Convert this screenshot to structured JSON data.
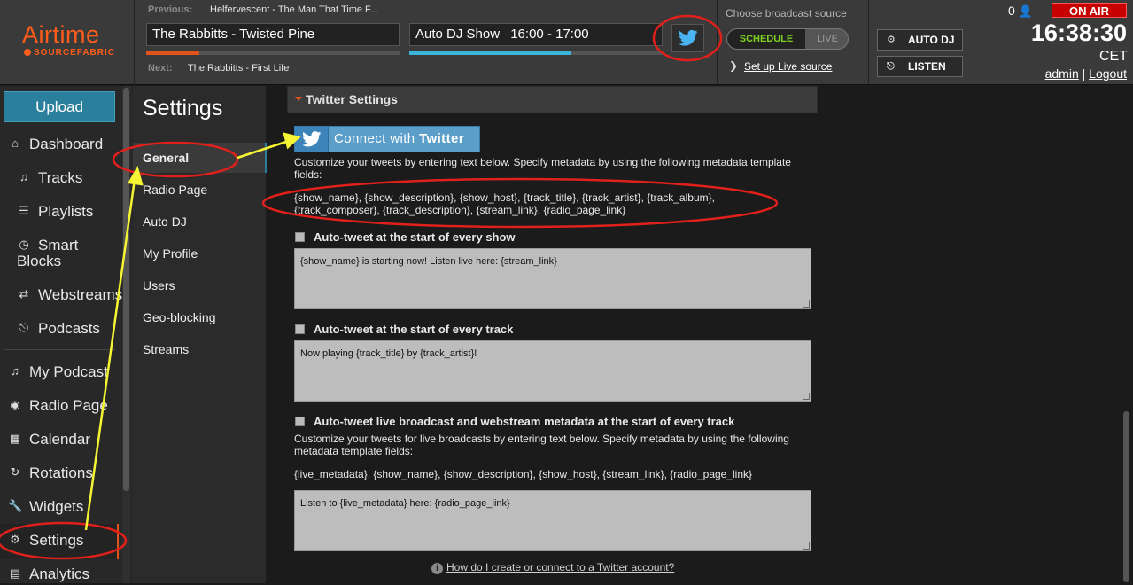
{
  "header": {
    "logo": {
      "name": "Airtime",
      "sub": "SOURCEFABRIC"
    },
    "previous_label": "Previous:",
    "previous_value": "Helfervescent - The Man That Time F...",
    "current_track": "The Rabbitts - Twisted Pine",
    "current_track_progress": 0.21,
    "current_show": "Auto DJ Show",
    "current_show_time": "16:00 - 17:00",
    "current_show_progress": 0.64,
    "next_label": "Next:",
    "next_value": "The Rabbitts - First Life",
    "source_title": "Choose broadcast source",
    "source_schedule": "SCHEDULE",
    "source_live": "LIVE",
    "setup_live": "Set up Live source",
    "autodj_label": "AUTO DJ",
    "listen_label": "LISTEN",
    "listener_count": "0",
    "onair": "ON AIR",
    "clock": "16:38:30",
    "timezone": "CET",
    "user": "admin",
    "separator": "|",
    "logout": "Logout"
  },
  "nav": {
    "upload": "Upload",
    "items": [
      {
        "label": "Dashboard",
        "icon": "home-icon"
      },
      {
        "label": "Tracks",
        "icon": "music-note-icon"
      },
      {
        "label": "Playlists",
        "icon": "list-icon"
      },
      {
        "label": "Smart",
        "label2": "Blocks",
        "icon": "clock-icon"
      },
      {
        "label": "Webstreams",
        "icon": "shuffle-icon"
      },
      {
        "label": "Podcasts",
        "icon": "headphones-icon"
      },
      {
        "label": "My Podcast",
        "icon": "music-note-icon"
      },
      {
        "label": "Radio Page",
        "icon": "globe-icon"
      },
      {
        "label": "Calendar",
        "icon": "calendar-icon"
      },
      {
        "label": "Rotations",
        "icon": "refresh-icon"
      },
      {
        "label": "Widgets",
        "icon": "wrench-icon"
      },
      {
        "label": "Settings",
        "icon": "gear-icon"
      },
      {
        "label": "Analytics",
        "icon": "bar-chart-icon"
      }
    ]
  },
  "settings_nav": {
    "title": "Settings",
    "items": [
      "General",
      "Radio Page",
      "Auto DJ",
      "My Profile",
      "Users",
      "Geo-blocking",
      "Streams"
    ]
  },
  "twitter": {
    "section_title": "Twitter Settings",
    "connect_prefix": "Connect with ",
    "connect_brand": "Twitter",
    "help1": "Customize your tweets by entering text below. Specify metadata by using the following metadata template fields:",
    "fields1": "{show_name}, {show_description}, {show_host}, {track_title}, {track_artist}, {track_album}, {track_composer}, {track_description}, {stream_link}, {radio_page_link}",
    "show_chk_label": "Auto-tweet at the start of every show",
    "show_text": "{show_name} is starting now! Listen live here: {stream_link}",
    "track_chk_label": "Auto-tweet at the start of every track",
    "track_text": "Now playing {track_title} by {track_artist}!",
    "live_chk_label": "Auto-tweet live broadcast and webstream metadata at the start of every track",
    "help2": "Customize your tweets for live broadcasts by entering text below. Specify metadata by using the following metadata template fields:",
    "fields2": "{live_metadata}, {show_name}, {show_description}, {show_host}, {stream_link}, {radio_page_link}",
    "live_text": "Listen to {live_metadata} here: {radio_page_link}",
    "help_link": "How do I create or connect to a Twitter account?"
  },
  "colors": {
    "brand": "#ff5d1a",
    "accent_blue": "#2a7f9c",
    "on_air": "#c70000",
    "annotation_red": "#e0201a",
    "annotation_yellow": "#f5f534"
  }
}
